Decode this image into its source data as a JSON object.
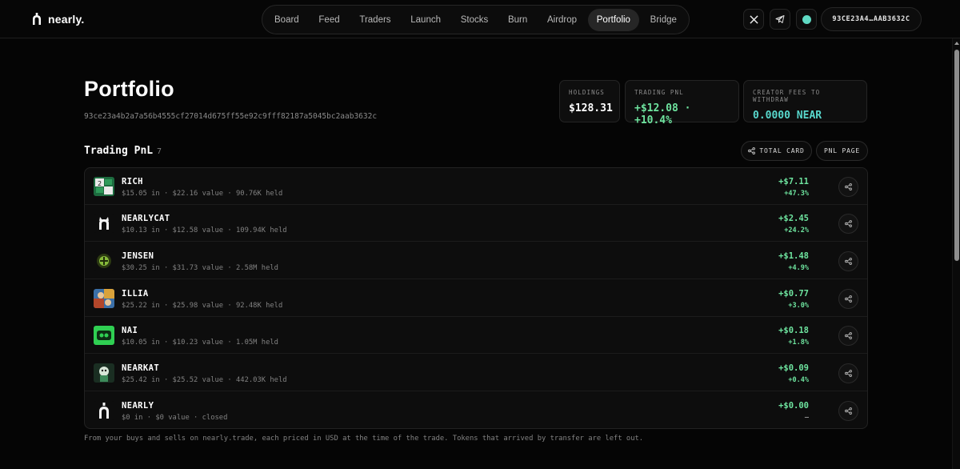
{
  "brand": {
    "name": "nearly."
  },
  "nav": {
    "tabs": [
      {
        "label": "Board",
        "active": false
      },
      {
        "label": "Feed",
        "active": false
      },
      {
        "label": "Traders",
        "active": false
      },
      {
        "label": "Launch",
        "active": false
      },
      {
        "label": "Stocks",
        "active": false
      },
      {
        "label": "Burn",
        "active": false
      },
      {
        "label": "Airdrop",
        "active": false
      },
      {
        "label": "Portfolio",
        "active": true
      },
      {
        "label": "Bridge",
        "active": false
      }
    ]
  },
  "header_actions": {
    "x_icon": "x-logo-icon",
    "telegram_icon": "telegram-icon",
    "status_icon": "status-dot-icon",
    "wallet": "93CE23A4…AAB3632C"
  },
  "page": {
    "title": "Portfolio",
    "address": "93ce23a4b2a7a56b4555cf27014d675ff55e92c9fff82187a5045bc2aab3632c"
  },
  "stats": {
    "holdings": {
      "label": "HOLDINGS",
      "value": "$128.31"
    },
    "trading_pnl": {
      "label": "TRADING PNL",
      "value": "+$12.08 · +10.4%"
    },
    "creator_fees": {
      "label": "CREATOR FEES TO WITHDRAW",
      "value": "0.0000 NEAR"
    }
  },
  "trading_pnl_section": {
    "title": "Trading PnL",
    "count": "7",
    "total_card_label": "TOTAL CARD",
    "pnl_page_label": "PNL PAGE",
    "rows": [
      {
        "name": "RICH",
        "meta": "$15.05 in · $22.16 value · 90.76K held",
        "pnl": "+$7.11",
        "pct": "+47.3%"
      },
      {
        "name": "NEARLYCAT",
        "meta": "$10.13 in · $12.58 value · 109.94K held",
        "pnl": "+$2.45",
        "pct": "+24.2%"
      },
      {
        "name": "JENSEN",
        "meta": "$30.25 in · $31.73 value · 2.58M held",
        "pnl": "+$1.48",
        "pct": "+4.9%"
      },
      {
        "name": "ILLIA",
        "meta": "$25.22 in · $25.98 value · 92.48K held",
        "pnl": "+$0.77",
        "pct": "+3.0%"
      },
      {
        "name": "NAI",
        "meta": "$10.05 in · $10.23 value · 1.05M held",
        "pnl": "+$0.18",
        "pct": "+1.8%"
      },
      {
        "name": "NEARKAT",
        "meta": "$25.42 in · $25.52 value · 442.03K held",
        "pnl": "+$0.09",
        "pct": "+0.4%"
      },
      {
        "name": "NEARLY",
        "meta": "$0 in · $0 value · closed",
        "pnl": "+$0.00",
        "pct": "–"
      }
    ],
    "footnote": "From your buys and sells on nearly.trade, each priced in USD at the time of the trade. Tokens that arrived by transfer are left out."
  },
  "colors": {
    "positive": "#6ee49f",
    "teal": "#58d7cc",
    "background": "#050505"
  }
}
